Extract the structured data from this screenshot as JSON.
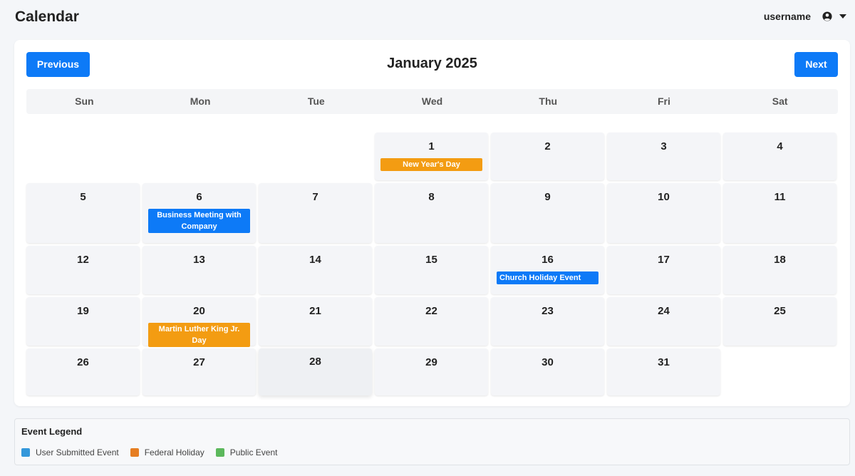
{
  "app": {
    "title": "Calendar"
  },
  "user": {
    "name": "username",
    "icon": "user-circle-icon",
    "menu_icon": "caret-down-icon"
  },
  "calendar": {
    "month_title": "January 2025",
    "prev_label": "Previous",
    "next_label": "Next",
    "today": "28",
    "weekdays": [
      "Sun",
      "Mon",
      "Tue",
      "Wed",
      "Thu",
      "Fri",
      "Sat"
    ],
    "weeks": [
      [
        "",
        "",
        "",
        "1",
        "2",
        "3",
        "4"
      ],
      [
        "5",
        "6",
        "7",
        "8",
        "9",
        "10",
        "11"
      ],
      [
        "12",
        "13",
        "14",
        "15",
        "16",
        "17",
        "18"
      ],
      [
        "19",
        "20",
        "21",
        "22",
        "23",
        "24",
        "25"
      ],
      [
        "26",
        "27",
        "28",
        "29",
        "30",
        "31",
        ""
      ]
    ],
    "events": {
      "1": {
        "title": "New Year's Day",
        "type": "federal"
      },
      "6": {
        "title": "Business Meeting with Company",
        "type": "user"
      },
      "16": {
        "title": "Church Holiday Event",
        "type": "user"
      },
      "20": {
        "title": "Martin Luther King Jr. Day",
        "type": "federal"
      }
    }
  },
  "legend": {
    "title": "Event Legend",
    "items": [
      {
        "label": "User Submitted Event",
        "color": "#3498db"
      },
      {
        "label": "Federal Holiday",
        "color": "#e67e22"
      },
      {
        "label": "Public Event",
        "color": "#5cb85c"
      }
    ]
  },
  "colors": {
    "accent": "#0d7af7",
    "federal_event": "#f39c12",
    "user_event": "#0d7af7"
  }
}
